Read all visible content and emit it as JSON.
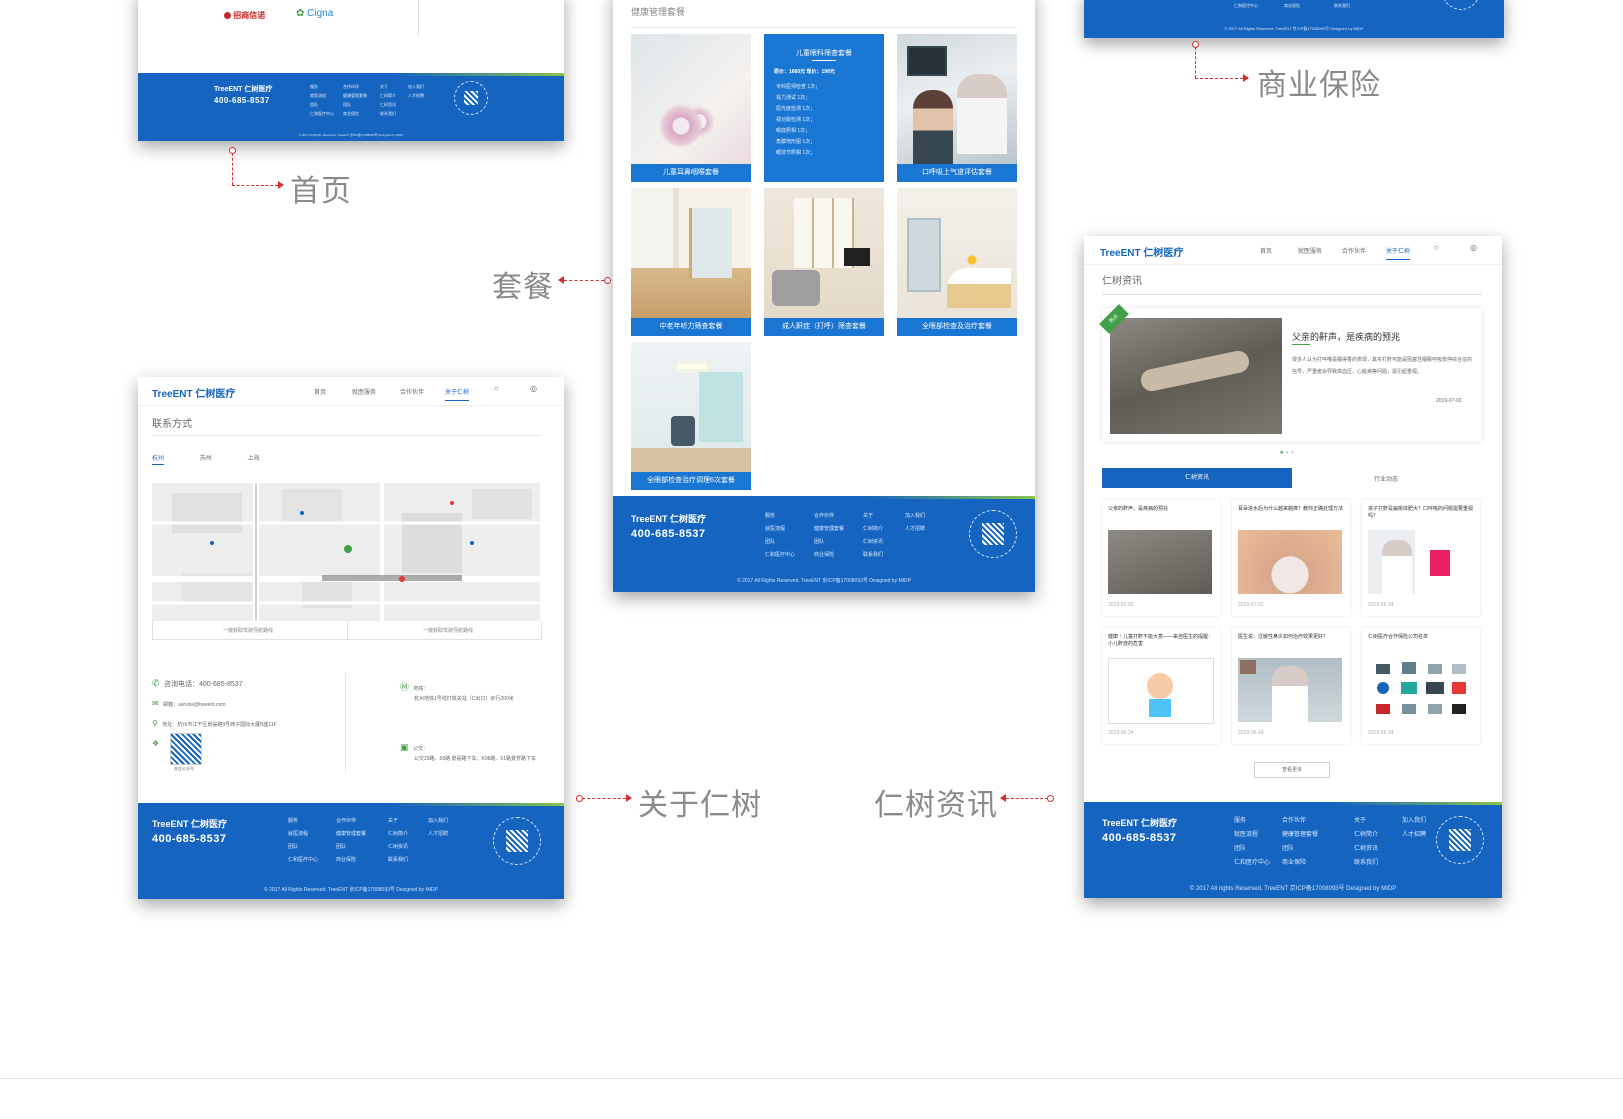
{
  "labels": {
    "home": "首页",
    "package": "套餐",
    "insurance": "商业保险",
    "about": "关于仁树",
    "news": "仁树资讯"
  },
  "brand": {
    "name": "TreeENT 仁树医疗",
    "tag": "",
    "phone": "400-685-8537",
    "copyright": "© 2017 All Rights Reserved. TreeENT 京ICP备17008093号 Designed by MIDP ",
    "copyright_news": "© 2017 All rights Reserved. TreeENT 京ICP备17008093号 Designed by MIDP"
  },
  "footer_cols": [
    [
      "服务",
      "就医流程",
      "团队",
      "仁和医疗中心"
    ],
    [
      "合作伙伴",
      "健康管理套餐",
      "团队",
      "商业保险"
    ],
    [
      "关于",
      "仁树简介",
      "仁树资讯",
      "联系我们"
    ],
    [
      "加入我们",
      "人才招聘",
      "",
      ""
    ]
  ],
  "home": {
    "partner1": "招商信诺",
    "partner2": "Cigna"
  },
  "package": {
    "heading": "健康管理套餐",
    "featured": {
      "title": "儿童眼科筛查套餐",
      "price": "原价：1680元  现价：198元",
      "lines": [
        "专科医师检查 1次；",
        "视力测试 1次；",
        "屈光度检测 1次；",
        "视功能检测 1次；",
        "眼底照相 1次；",
        "角膜地形图 1次；",
        "眼前节照相 1次；"
      ]
    },
    "tiles": [
      "儿童耳鼻咽喉套餐",
      "口呼吸上气道评估套餐",
      "中老年听力筛查套餐",
      "成人鼾症（打呼）筛查套餐",
      "全眼部检查及治疗套餐",
      "全眼部检查治疗调理6次套餐"
    ]
  },
  "about": {
    "nav": [
      "首页",
      "就医服务",
      "合作伙伴",
      "关于仁树"
    ],
    "title": "联系方式",
    "tabs": [
      "杭州",
      "苏州",
      "上海"
    ],
    "route_left": "一键获取驾驶导航路线",
    "route_right": "一键获取驾驶导航路线",
    "phone_label": "咨询电话：400-685-8537",
    "email": "邮箱：service@treeent.com",
    "address": "地址：杭州市江干区景昙路9号西子国际大厦B座11F",
    "qr_caption": "关注公众号",
    "subway_label": "地铁：",
    "subway_text": "杭州地铁1号线打铁关站（C出口）步行200米",
    "bus_label": "公交：",
    "bus_text": "公交29路、58路 景昙路下车；K98路、51路景芳路下车"
  },
  "news": {
    "nav": [
      "首页",
      "就医服务",
      "合作伙伴",
      "关于仁树"
    ],
    "title": "仁树资讯",
    "featured_title": "父亲的鼾声，是疾病的预兆",
    "featured_text": "很多人认为打呼噜是睡得香的表现，其实打鼾可能是阻塞性睡眠呼吸暂停综合征的信号，严重者会导致高血压、心脏病等问题，需引起重视。",
    "featured_date": "2019-07-02",
    "badge": "热点",
    "tab_active": "仁树资讯",
    "tab_other": "行业动态",
    "items": [
      {
        "title": "父亲的鼾声，是疾病的预兆",
        "date": "2019-07-02"
      },
      {
        "title": "耳朵进水后为什么越来越痒？教你正确处理方法",
        "date": "2019-07-02"
      },
      {
        "title": "孩子打鼾是扁桃体肥大？口呼吸的问题需要重视吗？",
        "date": "2019-06-24"
      },
      {
        "title": "健康｜儿童打鼾不能大意——来自医生的提醒：小儿鼾症的危害",
        "date": "2019-06-24"
      },
      {
        "title": "医生说：过敏性鼻炎如何治疗效果更好？",
        "date": "2019-06-24"
      },
      {
        "title": "仁树医疗合作保险公司名单",
        "date": "2019-06-24"
      }
    ],
    "more": "查看更多"
  }
}
